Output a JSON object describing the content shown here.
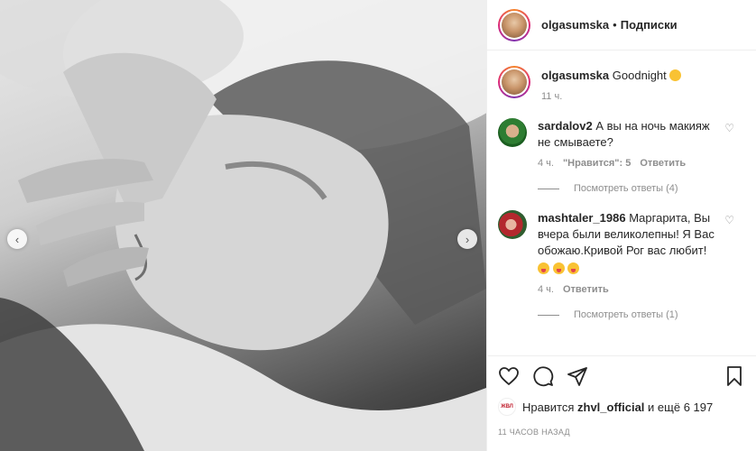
{
  "post": {
    "author": "olgasumska",
    "separator": "•",
    "follow_label": "Подписки",
    "caption": "Goodnight",
    "caption_time": "11 ч."
  },
  "comments": [
    {
      "username": "sardalov2",
      "text": "А вы на ночь макияж не смываете?",
      "time": "4 ч.",
      "likes": "\"Нравится\": 5",
      "reply_label": "Ответить",
      "view_replies": "Посмотреть ответы (4)"
    },
    {
      "username": "mashtaler_1986",
      "text": "Маргарита, Вы вчера были великолепны! Я Вас обожаю.Кривой Рог вас любит!",
      "time": "4 ч.",
      "reply_label": "Ответить",
      "view_replies": "Посмотреть ответы (1)"
    }
  ],
  "likes": {
    "mini_avatar_text": "ЖВЛ",
    "prefix": "Нравится",
    "user": "zhvl_official",
    "suffix": "и ещё 6 197"
  },
  "timestamp": "11 ЧАСОВ НАЗАД",
  "icons": {
    "like": "heart-icon",
    "comment": "comment-icon",
    "share": "share-icon",
    "save": "bookmark-icon",
    "prev": "chevron-left-icon",
    "next": "chevron-right-icon"
  },
  "nav": {
    "prev_glyph": "‹",
    "next_glyph": "›",
    "heart_glyph": "♡"
  }
}
